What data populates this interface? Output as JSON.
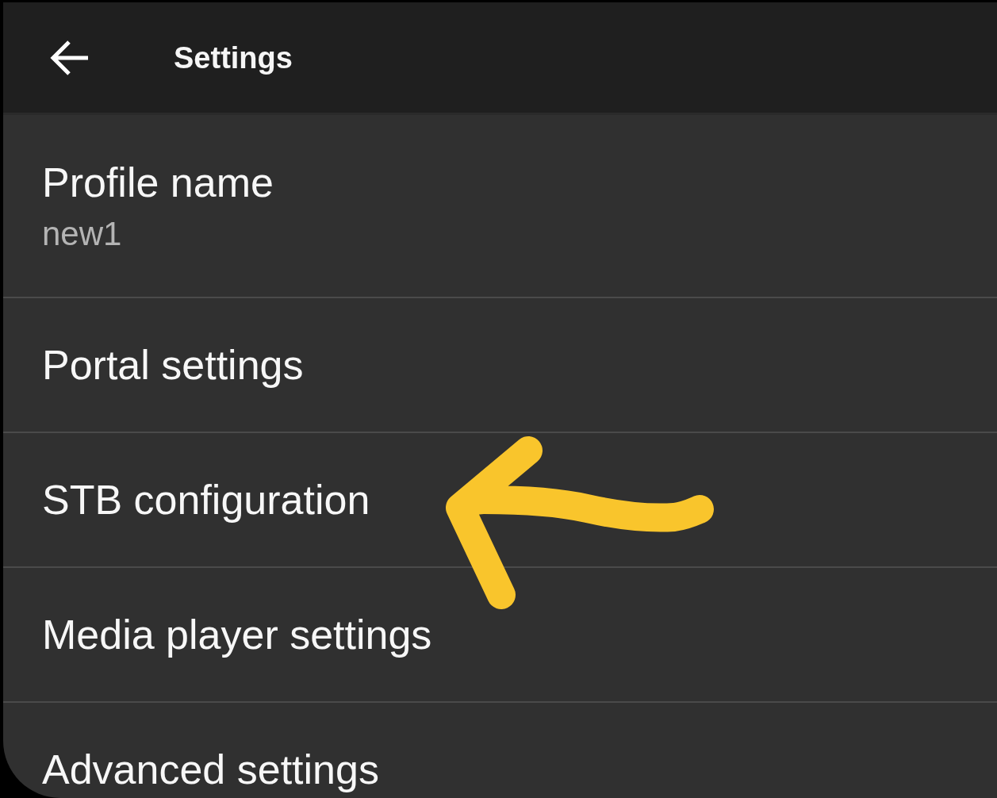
{
  "header": {
    "title": "Settings"
  },
  "items": [
    {
      "title": "Profile name",
      "subtitle": "new1",
      "annotated": false
    },
    {
      "title": "Portal settings",
      "annotated": false
    },
    {
      "title": "STB configuration",
      "annotated": true
    },
    {
      "title": "Media player settings",
      "annotated": false
    },
    {
      "title": "Advanced settings",
      "annotated": false
    }
  ]
}
